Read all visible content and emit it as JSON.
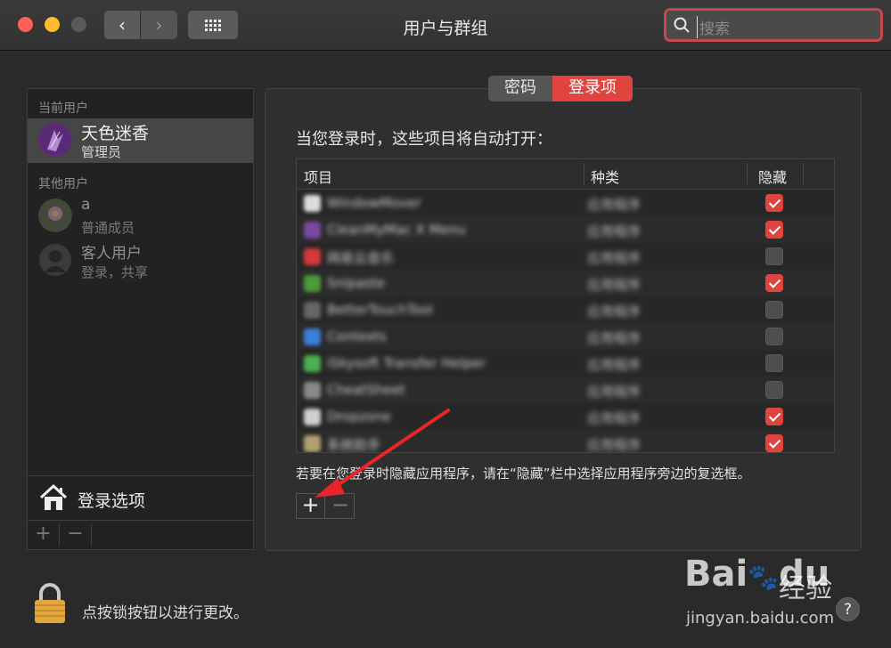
{
  "window": {
    "title": "用户与群组"
  },
  "toolbar": {
    "back_glyph": "‹",
    "forward_glyph": "›"
  },
  "search": {
    "placeholder": "搜索"
  },
  "sidebar": {
    "current_header": "当前用户",
    "current_user": {
      "name": "天色迷香",
      "role": "管理员"
    },
    "others_header": "其他用户",
    "other_users": [
      {
        "name": "a",
        "role": "普通成员"
      },
      {
        "name": "客人用户",
        "role": "登录，共享"
      }
    ],
    "login_options_label": "登录选项",
    "add_glyph": "+",
    "remove_glyph": "−"
  },
  "tabs": [
    {
      "label": "密码"
    },
    {
      "label": "登录项",
      "active": true
    }
  ],
  "login_items": {
    "heading": "当您登录时，这些项目将自动打开：",
    "columns": [
      "项目",
      "种类",
      "隐藏"
    ],
    "rows": [
      {
        "name": "WindowMover",
        "kind": "应用程序",
        "hidden": true,
        "icon_color": "#dcdcdc"
      },
      {
        "name": "CleanMyMac X Menu",
        "kind": "应用程序",
        "hidden": true,
        "icon_color": "#7a4aa0"
      },
      {
        "name": "网易云音乐",
        "kind": "应用程序",
        "hidden": false,
        "icon_color": "#d23a3a"
      },
      {
        "name": "Snipaste",
        "kind": "应用程序",
        "hidden": true,
        "icon_color": "#4c9a3a"
      },
      {
        "name": "BetterTouchTool",
        "kind": "应用程序",
        "hidden": false,
        "icon_color": "#666666"
      },
      {
        "name": "Contexts",
        "kind": "应用程序",
        "hidden": false,
        "icon_color": "#3a7fd8"
      },
      {
        "name": "iSkysoft Transfer Helper",
        "kind": "应用程序",
        "hidden": false,
        "icon_color": "#4caf50"
      },
      {
        "name": "CheatSheet",
        "kind": "应用程序",
        "hidden": false,
        "icon_color": "#8a8a8a"
      },
      {
        "name": "Dropzone",
        "kind": "应用程序",
        "hidden": true,
        "icon_color": "#cfcfcf"
      },
      {
        "name": "系统助手",
        "kind": "应用程序",
        "hidden": true,
        "icon_color": "#b0a070"
      }
    ],
    "hint": "若要在您登录时隐藏应用程序，请在“隐藏”栏中选择应用程序旁边的复选框。",
    "add_glyph": "+",
    "remove_glyph": "−"
  },
  "footer": {
    "lock_text": "点按锁按钮以进行更改。",
    "help_glyph": "?"
  },
  "watermark": {
    "logo": "Bai",
    "logo_tail": "du",
    "jingyan": "经验",
    "url": "jingyan.baidu.com"
  },
  "colors": {
    "accent": "#e0443e",
    "background": "#2a2a2a"
  }
}
